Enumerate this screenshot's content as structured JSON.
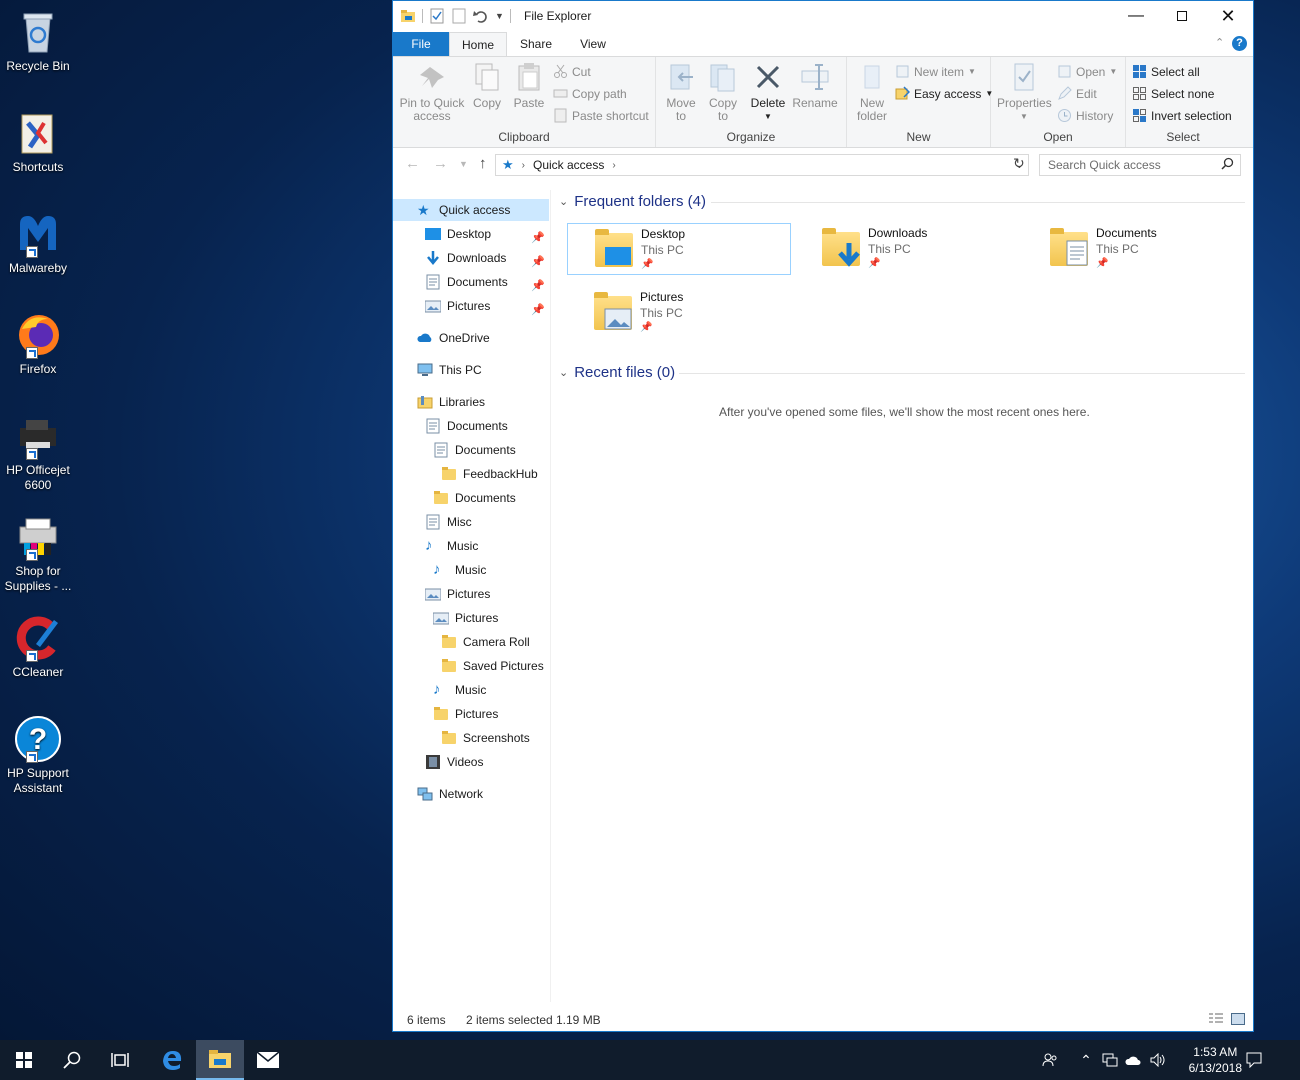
{
  "desktop": {
    "icons": [
      {
        "label": "Recycle Bin"
      },
      {
        "label": "Shortcuts"
      },
      {
        "label": "Malwareby"
      },
      {
        "label": "Firefox"
      },
      {
        "label": "HP Officejet 6600"
      },
      {
        "label": "Shop for Supplies - ..."
      },
      {
        "label": "CCleaner"
      },
      {
        "label": "HP Support Assistant"
      }
    ]
  },
  "window": {
    "title": "File Explorer",
    "tabs": {
      "file": "File",
      "home": "Home",
      "share": "Share",
      "view": "View"
    },
    "ribbon": {
      "clipboard": {
        "label": "Clipboard",
        "pin": "Pin to Quick access",
        "copy": "Copy",
        "paste": "Paste",
        "cut": "Cut",
        "copy_path": "Copy path",
        "paste_shortcut": "Paste shortcut"
      },
      "organize": {
        "label": "Organize",
        "move_to": "Move to",
        "copy_to": "Copy to",
        "delete": "Delete",
        "rename": "Rename"
      },
      "new": {
        "label": "New",
        "new_folder": "New folder",
        "new_item": "New item",
        "easy_access": "Easy access"
      },
      "open": {
        "label": "Open",
        "properties": "Properties",
        "open": "Open",
        "edit": "Edit",
        "history": "History"
      },
      "select": {
        "label": "Select",
        "select_all": "Select all",
        "select_none": "Select none",
        "invert": "Invert selection"
      }
    },
    "address": {
      "path": "Quick access"
    },
    "search": {
      "placeholder": "Search Quick access"
    },
    "nav": {
      "quick_access": "Quick access",
      "quick_items": [
        "Desktop",
        "Downloads",
        "Documents",
        "Pictures"
      ],
      "onedrive": "OneDrive",
      "this_pc": "This PC",
      "libraries": "Libraries",
      "lib_items": [
        "Documents",
        "Documents",
        "FeedbackHub",
        "Documents",
        "Misc",
        "Music",
        "Music",
        "Pictures",
        "Pictures",
        "Camera Roll",
        "Saved Pictures",
        "Music",
        "Pictures",
        "Screenshots",
        "Videos"
      ],
      "network": "Network"
    },
    "content": {
      "frequent_header": "Frequent folders (4)",
      "recent_header": "Recent files (0)",
      "recent_empty": "After you've opened some files, we'll show the most recent ones here.",
      "folders": [
        {
          "name": "Desktop",
          "location": "This PC"
        },
        {
          "name": "Downloads",
          "location": "This PC"
        },
        {
          "name": "Documents",
          "location": "This PC"
        },
        {
          "name": "Pictures",
          "location": "This PC"
        }
      ]
    },
    "status": {
      "items": "6 items",
      "selected": "2 items selected",
      "size": "1.19 MB"
    }
  },
  "taskbar": {
    "time": "1:53 AM",
    "date": "6/13/2018"
  }
}
